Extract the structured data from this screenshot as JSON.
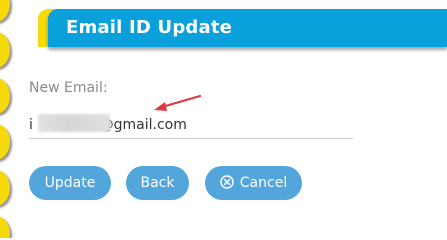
{
  "header": {
    "title": "Email ID Update"
  },
  "form": {
    "label": "New Email:",
    "value": "i           87@gmail.com"
  },
  "buttons": {
    "update": "Update",
    "back": "Back",
    "cancel": "Cancel"
  },
  "colors": {
    "header_blue": "#0aa0dc",
    "accent_yellow": "#f5d90a",
    "button_blue": "#53a6dc",
    "arrow_red": "#e0383e"
  },
  "icons": {
    "cancel": "circle-x-icon",
    "annotation": "red-arrow-icon"
  }
}
